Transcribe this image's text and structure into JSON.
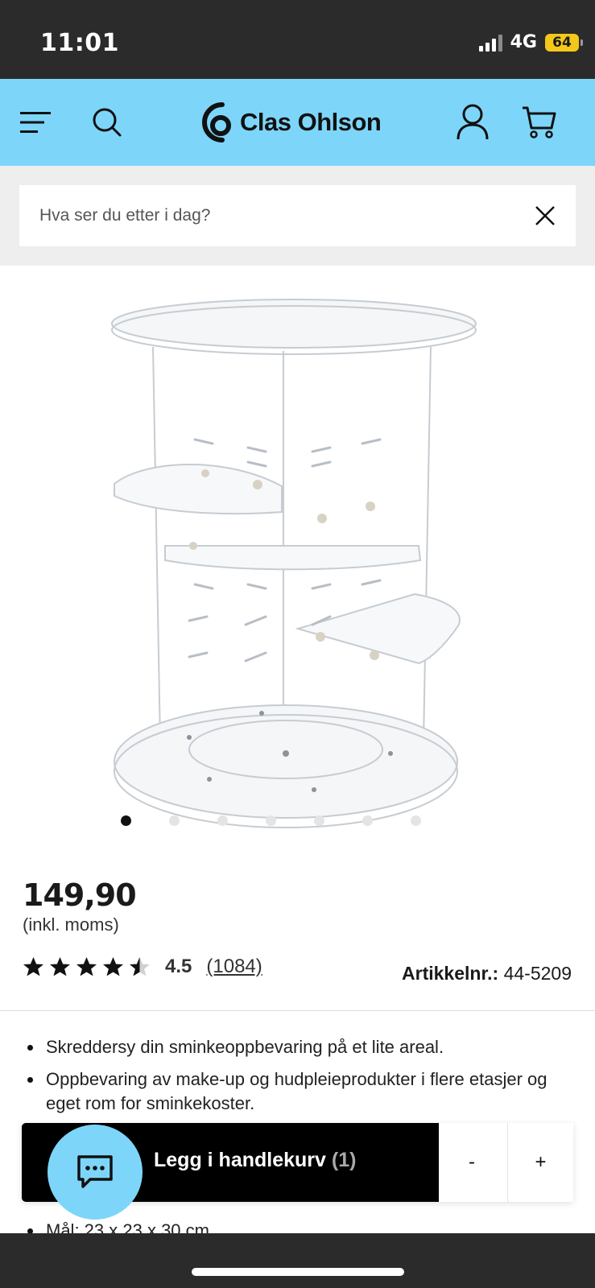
{
  "status_bar": {
    "time": "11:01",
    "network": "4G",
    "battery": "64"
  },
  "header": {
    "logo_text": "Clas Ohlson",
    "icons": [
      "menu-icon",
      "search-icon",
      "user-icon",
      "cart-icon"
    ]
  },
  "search": {
    "placeholder": "Hva ser du etter i dag?",
    "value": ""
  },
  "gallery": {
    "image_count": 7,
    "active_index": 0
  },
  "product": {
    "price": "149,90",
    "vat_note": "(inkl. moms)",
    "rating_value": "4.5",
    "rating_stars": 4.5,
    "rating_count": "(1084)",
    "article_label": "Artikkelnr.:",
    "article_number": "44-5209"
  },
  "features": [
    "Skreddersy din sminkeoppbevaring på et lite areal.",
    "Oppbevaring av make-up og hudpleieprodukter i flere etasjer og eget rom for sminkekoster.",
    "Mål: 23 x 23 x 30 cm"
  ],
  "cart_bar": {
    "label": "Legg i handlekurv",
    "quantity_display": "(1)",
    "minus_label": "-",
    "plus_label": "+"
  },
  "colors": {
    "brand_blue": "#7dd6f9",
    "cta_black": "#000000",
    "battery_yellow": "#f4c81a"
  }
}
